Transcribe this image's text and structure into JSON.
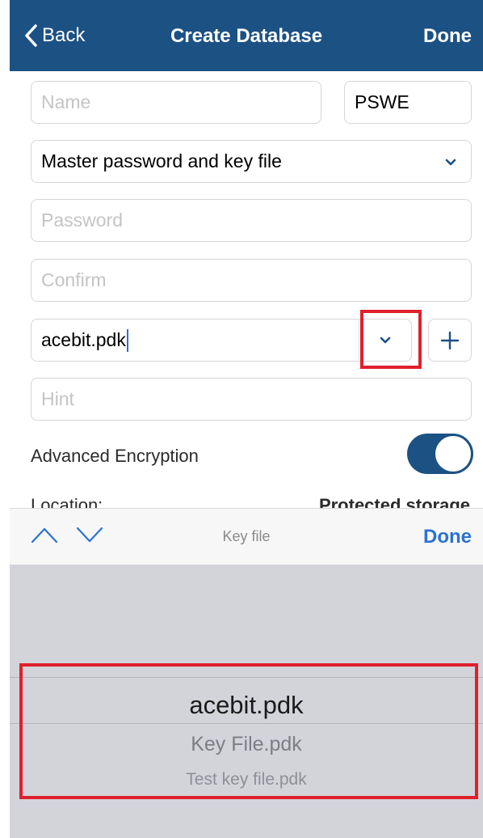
{
  "nav": {
    "back_label": "Back",
    "title": "Create Database",
    "done_label": "Done",
    "background_color": "#1c5184"
  },
  "form": {
    "name": {
      "placeholder": "Name",
      "value": ""
    },
    "extension": {
      "value": "PSWE"
    },
    "security_mode": {
      "value": "Master password and key file"
    },
    "password": {
      "placeholder": "Password",
      "value": ""
    },
    "confirm": {
      "placeholder": "Confirm",
      "value": ""
    },
    "key_file": {
      "value": "acebit.pdk"
    },
    "hint": {
      "placeholder": "Hint",
      "value": ""
    },
    "advanced_encryption": {
      "label": "Advanced Encryption",
      "enabled": true
    },
    "location": {
      "label": "Location:",
      "value": "Protected storage"
    }
  },
  "accessory": {
    "title": "Key file",
    "done_label": "Done",
    "accent_color": "#2b73cf"
  },
  "picker": {
    "selected": "acebit.pdk",
    "options": [
      "acebit.pdk",
      "Key File.pdk",
      "Test key file.pdk"
    ]
  },
  "highlight_color": "#e0202c"
}
